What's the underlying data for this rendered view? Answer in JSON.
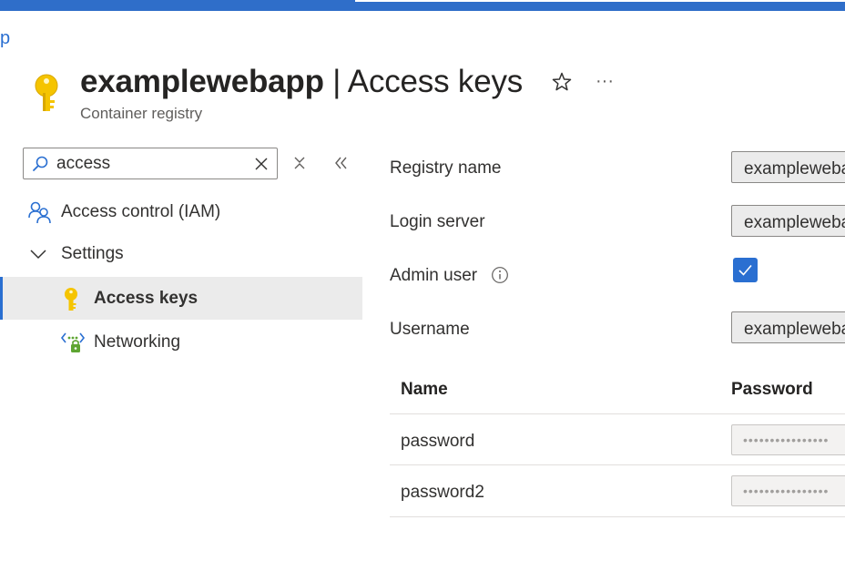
{
  "breadcrumb": {
    "tail": "p"
  },
  "header": {
    "resource_name": "examplewebapp",
    "separator": " | ",
    "page_title": "Access keys",
    "subtitle": "Container registry",
    "more_label": "···"
  },
  "search": {
    "value": "access",
    "placeholder": ""
  },
  "sidebar": {
    "items": [
      {
        "label": "Access control (IAM)",
        "icon": "people-icon"
      },
      {
        "label": "Settings",
        "icon": "chevron-down-icon"
      },
      {
        "label": "Access keys",
        "icon": "key-icon",
        "selected": true
      },
      {
        "label": "Networking",
        "icon": "networking-icon"
      }
    ]
  },
  "form": {
    "registry_name": {
      "label": "Registry name",
      "value": "examplewebapp"
    },
    "login_server": {
      "label": "Login server",
      "value": "examplewebapp.azurecr.io"
    },
    "admin_user": {
      "label": "Admin user",
      "checked": true
    },
    "username": {
      "label": "Username",
      "value": "examplewebapp"
    }
  },
  "passwords_table": {
    "columns": [
      "Name",
      "Password"
    ],
    "rows": [
      {
        "name": "password",
        "value": "••••••••••••••••"
      },
      {
        "name": "password2",
        "value": "••••••••••••••••"
      }
    ]
  },
  "colors": {
    "accent": "#2a6fd1",
    "key_gold": "#f5c400",
    "selected_bg": "#ebebeb"
  }
}
